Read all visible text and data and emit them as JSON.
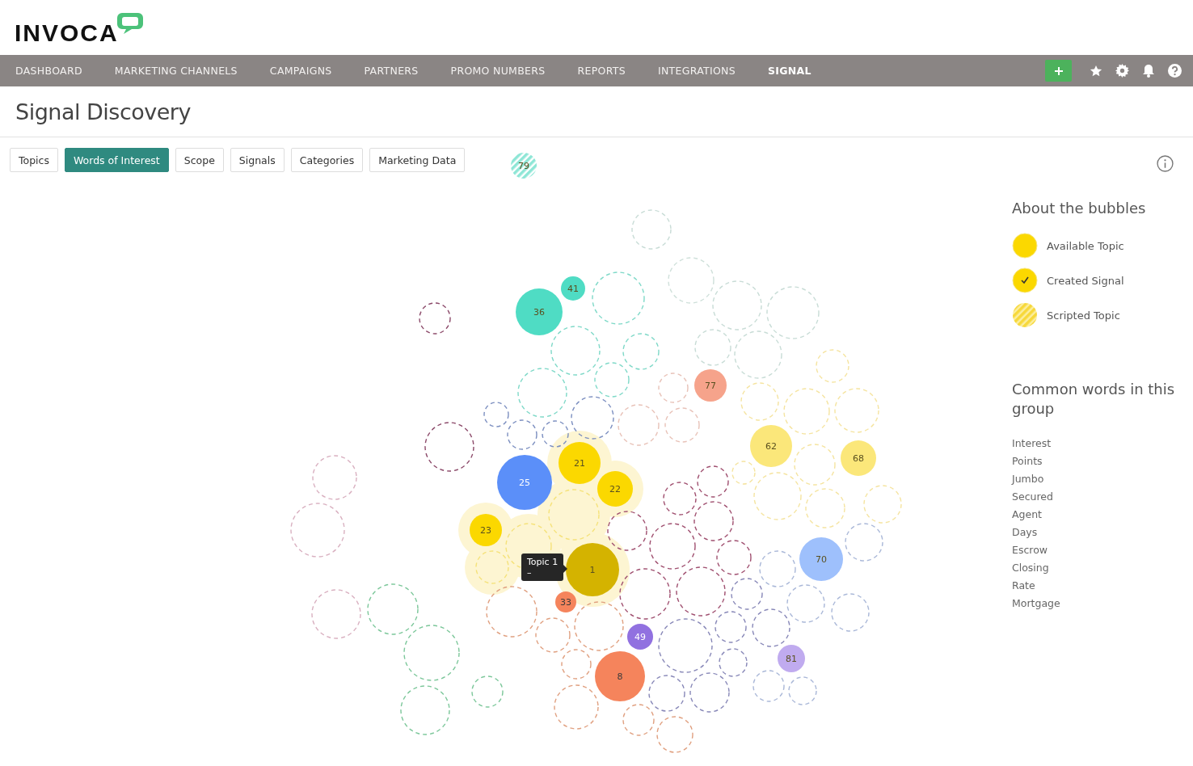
{
  "logo": {
    "text": "INVOCA"
  },
  "nav": [
    {
      "label": "DASHBOARD",
      "selected": false
    },
    {
      "label": "MARKETING CHANNELS",
      "selected": false
    },
    {
      "label": "CAMPAIGNS",
      "selected": false
    },
    {
      "label": "PARTNERS",
      "selected": false
    },
    {
      "label": "PROMO NUMBERS",
      "selected": false
    },
    {
      "label": "REPORTS",
      "selected": false
    },
    {
      "label": "INTEGRATIONS",
      "selected": false
    },
    {
      "label": "SIGNAL",
      "selected": true
    }
  ],
  "page_title": "Signal Discovery",
  "tabs": [
    {
      "label": "Topics",
      "selected": false
    },
    {
      "label": "Words of Interest",
      "selected": true
    },
    {
      "label": "Scope",
      "selected": false
    },
    {
      "label": "Signals",
      "selected": false
    },
    {
      "label": "Categories",
      "selected": false
    },
    {
      "label": "Marketing Data",
      "selected": false
    }
  ],
  "bubbles": [
    {
      "label": "79",
      "kind": "scripted",
      "color": "#8ee6d6"
    },
    {
      "label": "41",
      "kind": "available",
      "color": "#4fdcc4"
    },
    {
      "label": "36",
      "kind": "available",
      "color": "#4fdcc4"
    },
    {
      "label": "77",
      "kind": "available",
      "color": "#f6a38b"
    },
    {
      "label": "62",
      "kind": "available",
      "color": "#fbe77a"
    },
    {
      "label": "68",
      "kind": "available",
      "color": "#fbe77a"
    },
    {
      "label": "21",
      "kind": "available",
      "color": "#fbd800"
    },
    {
      "label": "25",
      "kind": "available",
      "color": "#5b8ff9"
    },
    {
      "label": "22",
      "kind": "available",
      "color": "#fbd800"
    },
    {
      "label": "23",
      "kind": "available",
      "color": "#fbd800"
    },
    {
      "label": "1",
      "kind": "available",
      "color": "#d4b300"
    },
    {
      "label": "70",
      "kind": "available",
      "color": "#9ec0fc"
    },
    {
      "label": "33",
      "kind": "available",
      "color": "#f5845c"
    },
    {
      "label": "49",
      "kind": "available",
      "color": "#9171e0"
    },
    {
      "label": "8",
      "kind": "available",
      "color": "#f5845c"
    },
    {
      "label": "81",
      "kind": "available",
      "color": "#c0abef"
    }
  ],
  "tooltip": {
    "title": "Topic 1",
    "text": "–"
  },
  "legend": {
    "title": "About the bubbles",
    "items": [
      {
        "label": "Available Topic",
        "kind": "available"
      },
      {
        "label": "Created Signal",
        "kind": "created"
      },
      {
        "label": "Scripted Topic",
        "kind": "scripted"
      }
    ]
  },
  "common_words": {
    "title": "Common words in this group",
    "words": [
      "Interest",
      "Points",
      "Jumbo",
      "Secured",
      "Agent",
      "Days",
      "Escrow",
      "Closing",
      "Rate",
      "Mortgage"
    ]
  }
}
